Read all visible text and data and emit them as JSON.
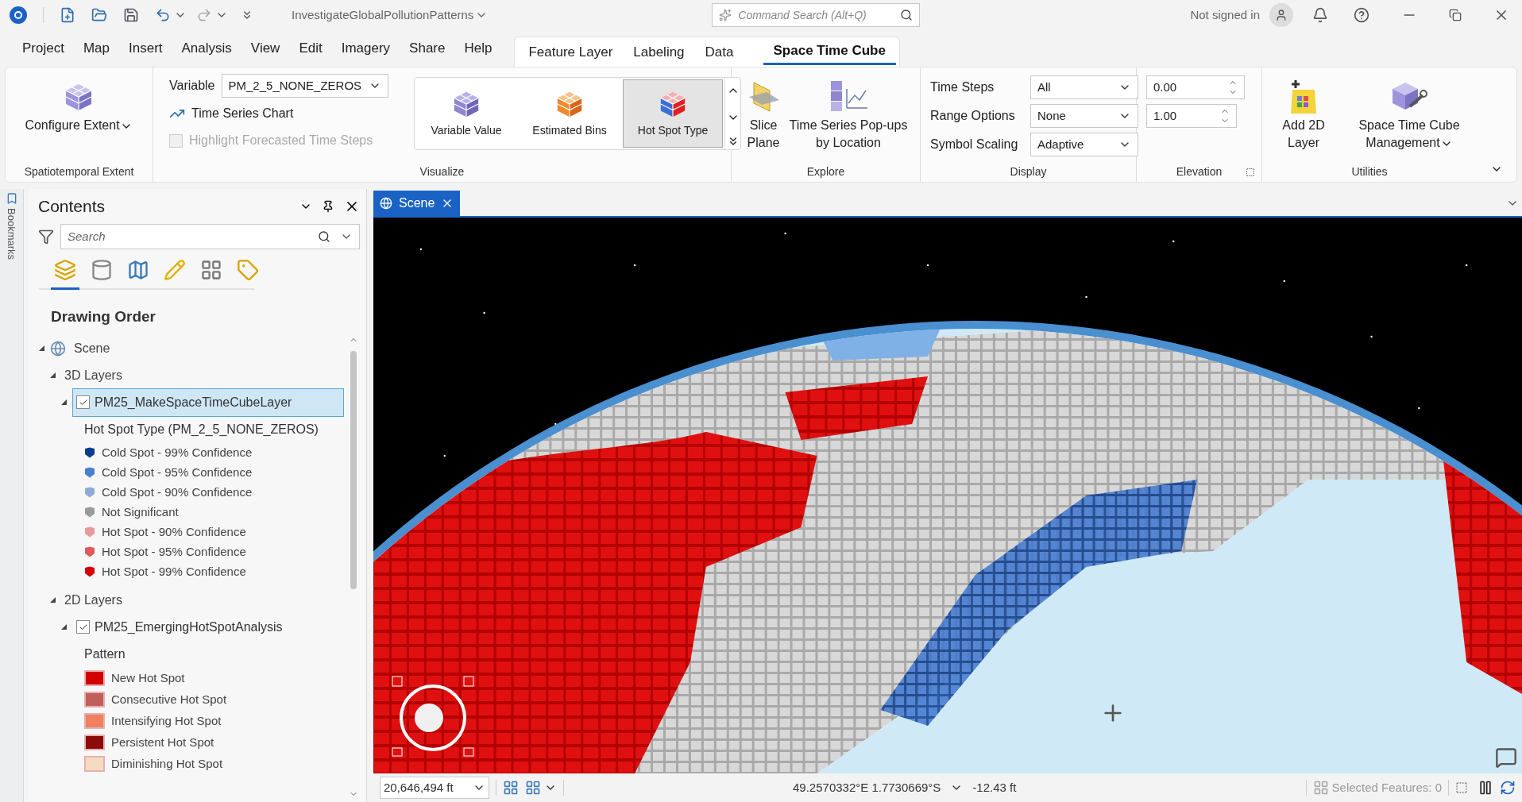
{
  "window": {
    "title": "InvestigateGlobalPollutionPatterns",
    "search_placeholder": "Command Search (Alt+Q)",
    "user": "Not signed in"
  },
  "menu": [
    {
      "label": "Project",
      "selected": false
    },
    {
      "label": "Map",
      "selected": false
    },
    {
      "label": "Insert",
      "selected": false
    },
    {
      "label": "Analysis",
      "selected": false
    },
    {
      "label": "View",
      "selected": false
    },
    {
      "label": "Edit",
      "selected": false
    },
    {
      "label": "Imagery",
      "selected": false
    },
    {
      "label": "Share",
      "selected": false
    },
    {
      "label": "Help",
      "selected": false
    }
  ],
  "contextual_tabs": [
    {
      "label": "Feature Layer",
      "selected": false
    },
    {
      "label": "Labeling",
      "selected": false
    },
    {
      "label": "Data",
      "selected": false
    },
    {
      "label": "Space Time Cube",
      "selected": true
    }
  ],
  "ribbon": {
    "spatiotemporal": {
      "label": "Spatiotemporal Extent",
      "button": "Configure Extent"
    },
    "visualize": {
      "label": "Visualize",
      "variable_label": "Variable",
      "variable_value": "PM_2_5_NONE_ZEROS",
      "chart_button": "Time Series Chart",
      "highlight": {
        "label": "Highlight Forecasted Time Steps",
        "checked": false,
        "disabled": true
      },
      "gallery": [
        {
          "label": "Variable Value",
          "kind": "value",
          "selected": false
        },
        {
          "label": "Estimated Bins",
          "kind": "bins",
          "selected": false
        },
        {
          "label": "Hot Spot Type",
          "kind": "hotspot",
          "selected": true
        }
      ]
    },
    "explore": {
      "label": "Explore",
      "buttons": [
        {
          "label": "Slice Plane",
          "kind": "slice"
        },
        {
          "label": "Time Series Pop-ups by Location",
          "kind": "popups"
        }
      ]
    },
    "display": {
      "label": "Display",
      "rows": [
        {
          "label": "Time Steps",
          "value": "All"
        },
        {
          "label": "Range Options",
          "value": "None"
        },
        {
          "label": "Symbol Scaling",
          "value": "Adaptive"
        }
      ]
    },
    "elevation": {
      "label": "Elevation",
      "values": [
        "0.00",
        "1.00"
      ]
    },
    "utilities": {
      "label": "Utilities",
      "buttons": [
        {
          "label": "Add 2D Layer",
          "kind": "add",
          "menu": false
        },
        {
          "label": "Space Time Cube Management",
          "kind": "manage",
          "menu": true
        }
      ]
    }
  },
  "bookmarks": {
    "label": "Bookmarks"
  },
  "contents": {
    "title": "Contents",
    "search_placeholder": "Search",
    "heading": "Drawing Order",
    "views": [
      {
        "kind": "drawing-order",
        "selected": true
      },
      {
        "kind": "source",
        "selected": false
      },
      {
        "kind": "selection",
        "selected": false
      },
      {
        "kind": "editing",
        "selected": false
      },
      {
        "kind": "snapping",
        "selected": false
      },
      {
        "kind": "labeling",
        "selected": false
      }
    ],
    "tree": [
      {
        "label": "Scene",
        "kind": "scene",
        "expanded": true,
        "selected": false,
        "children": [
          {
            "label": "3D Layers",
            "kind": "group",
            "expanded": true,
            "selected": false,
            "children": [
              {
                "label": "PM25_MakeSpaceTimeCubeLayer",
                "kind": "layer",
                "expanded": true,
                "checked": true,
                "selected": true,
                "legend": {
                  "heading": "Hot Spot Type (PM_2_5_NONE_ZEROS)",
                  "kind": "cube",
                  "items": [
                    {
                      "label": "Cold Spot - 99% Confidence",
                      "color": "#0b3d91"
                    },
                    {
                      "label": "Cold Spot - 95% Confidence",
                      "color": "#4a7fd0"
                    },
                    {
                      "label": "Cold Spot - 90% Confidence",
                      "color": "#8fa8d8"
                    },
                    {
                      "label": "Not Significant",
                      "color": "#9a9a9a"
                    },
                    {
                      "label": "Hot Spot - 90% Confidence",
                      "color": "#e89a9a"
                    },
                    {
                      "label": "Hot Spot - 95% Confidence",
                      "color": "#e05a5a"
                    },
                    {
                      "label": "Hot Spot - 99% Confidence",
                      "color": "#d40000"
                    }
                  ]
                }
              }
            ]
          },
          {
            "label": "2D Layers",
            "kind": "group",
            "expanded": true,
            "selected": false,
            "children": [
              {
                "label": "PM25_EmergingHotSpotAnalysis",
                "kind": "layer",
                "expanded": true,
                "checked": true,
                "selected": false,
                "legend": {
                  "heading": "Pattern",
                  "kind": "fill",
                  "items": [
                    {
                      "label": "New Hot Spot",
                      "color": "#d40000"
                    },
                    {
                      "label": "Consecutive Hot Spot",
                      "color": "#c0605a"
                    },
                    {
                      "label": "Intensifying Hot Spot",
                      "color": "#ef8060"
                    },
                    {
                      "label": "Persistent Hot Spot",
                      "color": "#8b0a0a"
                    },
                    {
                      "label": "Diminishing Hot Spot",
                      "color": "#f5dcc0"
                    }
                  ]
                }
              }
            ]
          }
        ]
      }
    ]
  },
  "map_tabs": [
    {
      "label": "Scene",
      "selected": true
    }
  ],
  "status_bar": {
    "scale": "20,646,494 ft",
    "coordinates": "49.2570332°E 1.7730669°S",
    "elevation": "-12.43 ft",
    "selected_features": "Selected Features: 0"
  }
}
